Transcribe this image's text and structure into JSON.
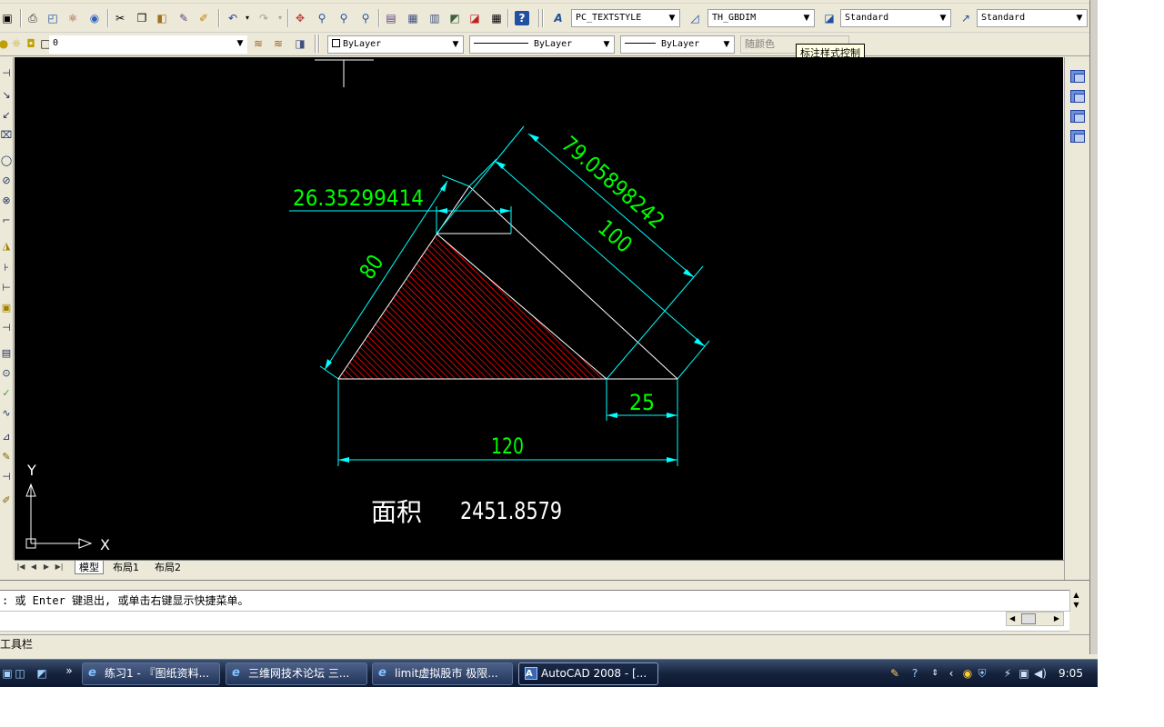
{
  "toolbar1": {
    "text_style": "PC_TEXTSTYLE",
    "dim_style": "TH_GBDIM",
    "table_style": "Standard",
    "multileader_style": "Standard"
  },
  "toolbar2": {
    "layer": "0",
    "color": "ByLayer",
    "linetype": "ByLayer",
    "lineweight": "ByLayer",
    "plot_style": "随颜色"
  },
  "tooltip": "标注样式控制",
  "drawing": {
    "dim_top_left": "26.35299414",
    "dim_diagonal_outer": "79.05898242",
    "dim_diagonal_inner": "100",
    "dim_left_side": "80",
    "dim_bottom_right": "25",
    "dim_base": "120",
    "area_label": "面积",
    "area_value": "2451.8579",
    "colors": {
      "geometry": "#ffffff",
      "dimension": "#00ffff",
      "dim_text": "#00ff00",
      "hatch": "#ff0000"
    }
  },
  "ucs": {
    "y_label": "Y",
    "x_label": "X"
  },
  "layout_tabs": {
    "model": "模型",
    "layout1": "布局1",
    "layout2": "布局2"
  },
  "command": {
    "history": ": 或 Enter 键退出, 或单击右键显示快捷菜单。"
  },
  "status_bar": {
    "text": "工具栏"
  },
  "taskbar": {
    "chevron": "»",
    "buttons": [
      {
        "label": "练习1 - 『图纸资料...",
        "icon": "ie-icon"
      },
      {
        "label": "三维网技术论坛 三...",
        "icon": "ie-icon"
      },
      {
        "label": "limit虚拟股市 极限...",
        "icon": "ie-icon"
      },
      {
        "label": "AutoCAD 2008 - [...",
        "icon": "autocad-icon"
      }
    ],
    "clock": "9:05"
  }
}
